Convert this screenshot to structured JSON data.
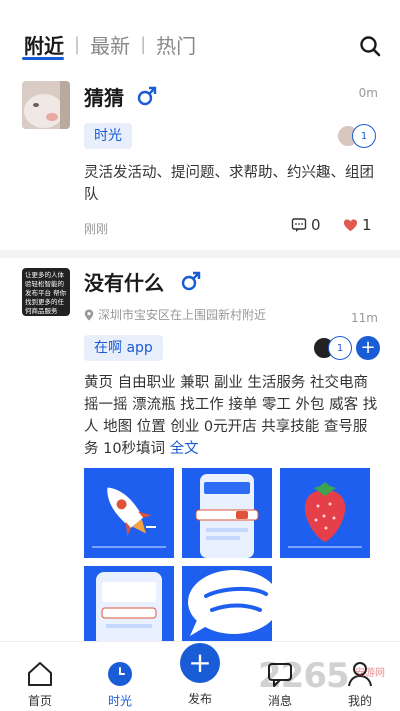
{
  "tabs": [
    {
      "label": "附近",
      "active": true
    },
    {
      "label": "最新",
      "active": false
    },
    {
      "label": "热门",
      "active": false
    }
  ],
  "colors": {
    "accent": "#1a5bd6",
    "male": "#1a5bd6",
    "heart": "#e05a4f",
    "tile_blue": "#1e5ff0"
  },
  "posts": [
    {
      "username": "猜猜",
      "gender": "male",
      "time_ago": "0m",
      "channel": "时光",
      "joined_count": "1",
      "body": "灵活发活动、提问题、求帮助、约兴趣、组团队",
      "posted": "刚刚",
      "comments": "0",
      "likes": "1"
    },
    {
      "username": "没有什么",
      "gender": "male",
      "time_ago": "11m",
      "location": "深圳市宝安区在上围园新村附近",
      "channel": "在啊 app",
      "joined_count": "1",
      "plus": "+",
      "body": "黄页 自由职业 兼职 副业 生活服务 社交电商 摇一摇 漂流瓶 找工作 接单 零工 外包 威客 找人 地图 位置 创业 0元开店 共享技能 查号服务 10秒填词",
      "more": "全文",
      "avatar_text": "让更多的人体验轻松智能的发布平台 帮你找到更多的任何商品服务"
    }
  ],
  "nav": [
    {
      "label": "首页",
      "icon": "home-icon"
    },
    {
      "label": "时光",
      "icon": "clock-icon",
      "active": true
    },
    {
      "label": "发布",
      "icon": "plus-icon"
    },
    {
      "label": "消息",
      "icon": "chat-icon"
    },
    {
      "label": "我的",
      "icon": "user-icon"
    }
  ],
  "watermark": {
    "text": "2265",
    "sub": "安游网"
  }
}
